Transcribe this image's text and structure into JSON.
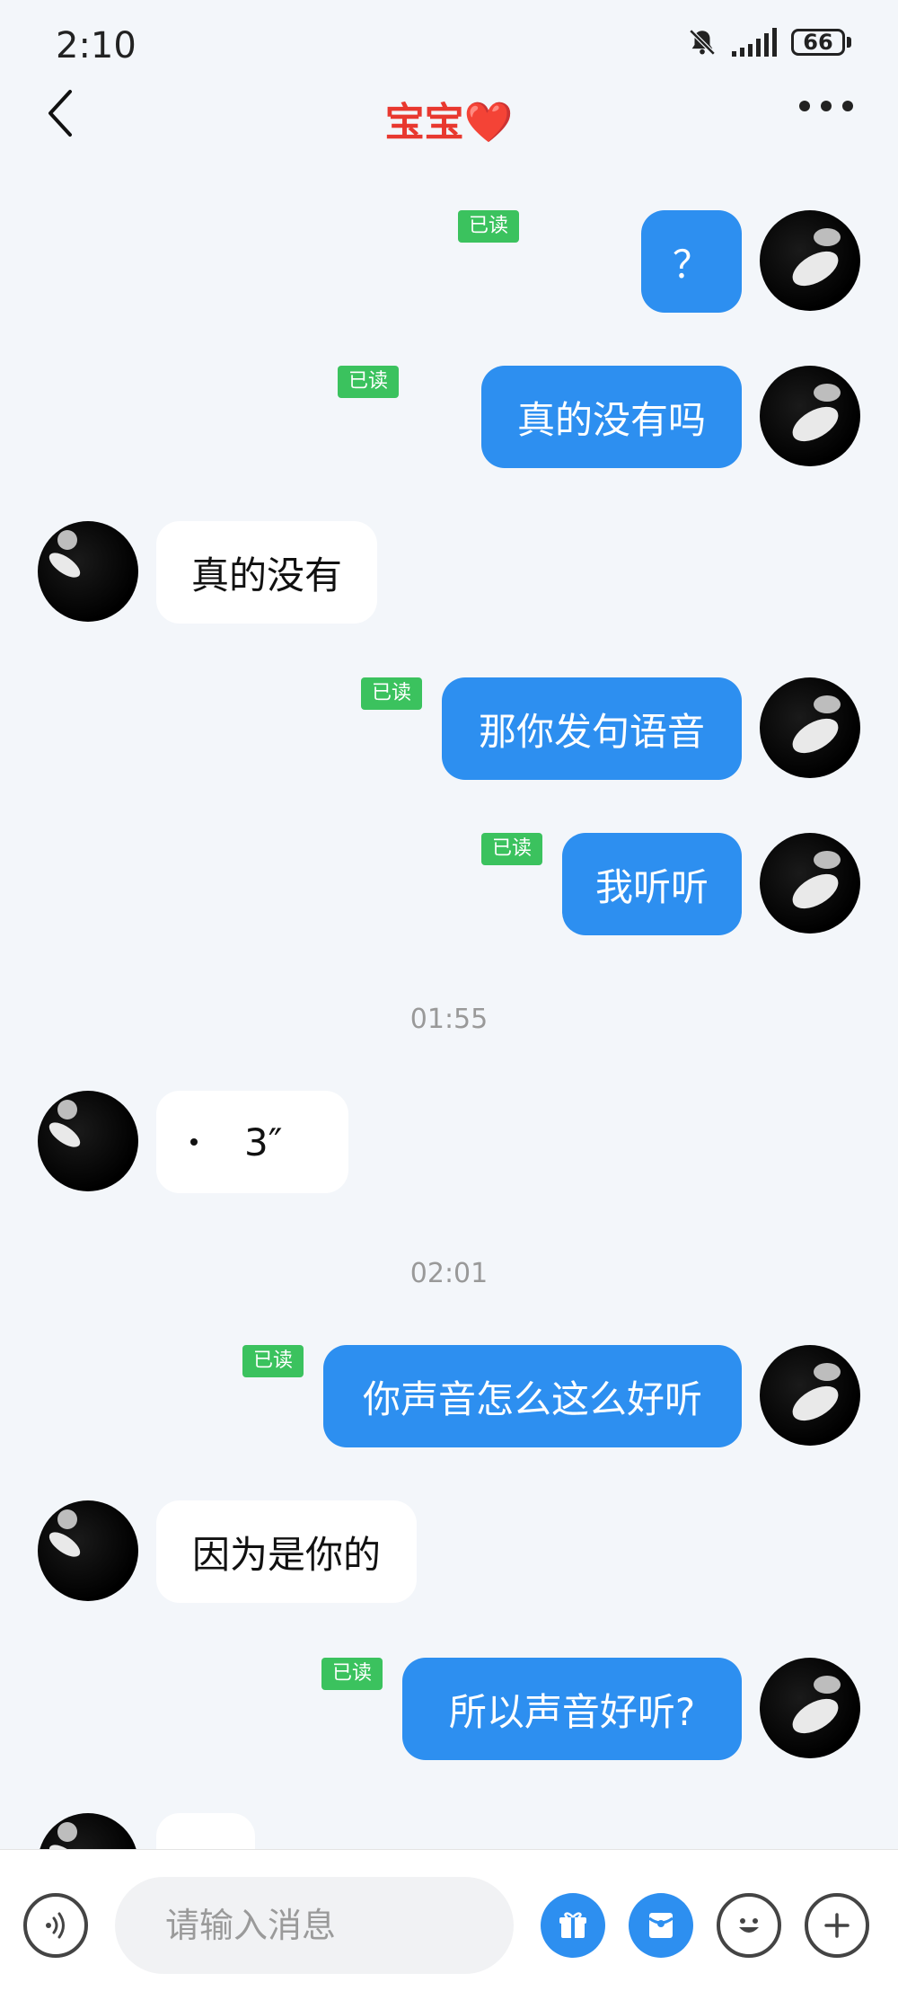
{
  "status_bar": {
    "time": "2:10",
    "battery": "66"
  },
  "header": {
    "title": "宝宝❤️"
  },
  "messages": [
    {
      "dir": "out",
      "text": "？",
      "read": "已读"
    },
    {
      "dir": "out",
      "text": "真的没有吗",
      "read": "已读"
    },
    {
      "dir": "in",
      "text": "真的没有"
    },
    {
      "dir": "out",
      "text": "那你发句语音",
      "read": "已读"
    },
    {
      "dir": "out",
      "text": "我听听",
      "read": "已读"
    },
    {
      "time": "01:55"
    },
    {
      "dir": "in",
      "voice_duration": "3″"
    },
    {
      "time": "02:01"
    },
    {
      "dir": "out",
      "text": "你声音怎么这么好听",
      "read": "已读"
    },
    {
      "dir": "in",
      "text": "因为是你的"
    },
    {
      "dir": "out",
      "text": "所以声音好听?",
      "read": "已读"
    }
  ],
  "input": {
    "placeholder": "请输入消息"
  },
  "icons": {
    "voice": "voice-wave-icon",
    "gift": "gift-icon",
    "red_packet": "red-packet-icon",
    "emoji": "emoji-icon",
    "plus": "plus-icon"
  }
}
